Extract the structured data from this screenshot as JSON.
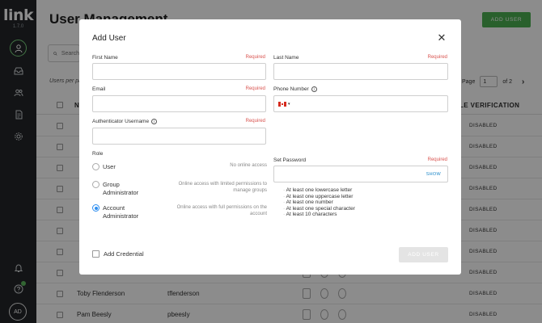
{
  "app": {
    "logo": "link",
    "version": "1.7.0",
    "avatar_initials": "AD"
  },
  "sidebar": {
    "icons": [
      "user-icon",
      "inbox-icon",
      "users-icon",
      "document-icon",
      "gear-icon",
      "bell-icon",
      "help-icon"
    ]
  },
  "page": {
    "title": "User Management",
    "add_user_button": "ADD USER",
    "search_placeholder": "Search",
    "per_page_label": "Users per pa",
    "pager": {
      "label": "Page",
      "current": "1",
      "total_text": "of 2"
    },
    "columns": {
      "name": "N",
      "verification": "LE VERIFICATION"
    },
    "rows": [
      {
        "name": "",
        "username": "",
        "status": "DISABLED"
      },
      {
        "name": "",
        "username": "",
        "status": "DISABLED"
      },
      {
        "name": "",
        "username": "",
        "status": "DISABLED"
      },
      {
        "name": "",
        "username": "",
        "status": "DISABLED"
      },
      {
        "name": "",
        "username": "",
        "status": "DISABLED"
      },
      {
        "name": "",
        "username": "",
        "status": "DISABLED"
      },
      {
        "name": "",
        "username": "",
        "status": "DISABLED"
      },
      {
        "name": "",
        "username": "",
        "status": "DISABLED"
      },
      {
        "name": "Toby Flenderson",
        "username": "tflenderson",
        "status": "DISABLED"
      },
      {
        "name": "Pam Beesly",
        "username": "pbeesly",
        "status": "DISABLED"
      }
    ]
  },
  "modal": {
    "title": "Add User",
    "required": "Required",
    "first_name": {
      "label": "First Name",
      "value": ""
    },
    "last_name": {
      "label": "Last Name",
      "value": ""
    },
    "email": {
      "label": "Email",
      "value": ""
    },
    "phone": {
      "label": "Phone Number",
      "country": "CA",
      "value": ""
    },
    "auth_username": {
      "label": "Authenticator Username",
      "value": ""
    },
    "role": {
      "label": "Role",
      "options": [
        {
          "name": "User",
          "description": "No online access",
          "selected": false
        },
        {
          "name": "Group Administrator",
          "description": "Online access with limited permissions to manage groups",
          "selected": false
        },
        {
          "name": "Account Administrator",
          "description": "Online access with full permissions on the account",
          "selected": true
        }
      ]
    },
    "password": {
      "label": "Set Password",
      "show_label": "SHOW",
      "rules": [
        "At least one lowercase letter",
        "At least one uppercase letter",
        "At least one number",
        "At least one special character",
        "At least 10 characters"
      ]
    },
    "add_credential_label": "Add Credential",
    "submit_label": "ADD USER"
  },
  "colors": {
    "accent_green": "#4caf50",
    "link_blue": "#1e88c9",
    "required_red": "#d9534f",
    "sidebar_bg": "#232629"
  }
}
